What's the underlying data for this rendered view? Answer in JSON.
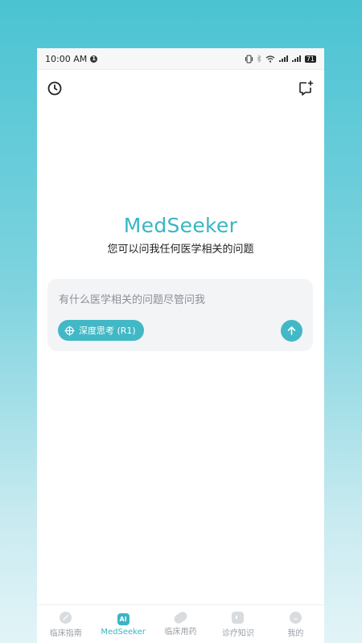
{
  "status_bar": {
    "time": "10:00 AM",
    "notification_count": "1",
    "battery": "71"
  },
  "header": {
    "history_icon": "clock-icon",
    "new_chat_icon": "new-chat-icon"
  },
  "brand": {
    "title": "MedSeeker",
    "subtitle": "您可以问我任何医学相关的问题"
  },
  "chat_input": {
    "placeholder": "有什么医学相关的问题尽管问我",
    "deep_think_label": "深度思考 (R1)",
    "send_icon": "arrow-up-icon"
  },
  "tabs": [
    {
      "label": "临床指南",
      "icon": "guide-icon",
      "active": false
    },
    {
      "label": "MedSeeker",
      "icon": "ai-icon",
      "icon_text": "AI",
      "active": true
    },
    {
      "label": "临床用药",
      "icon": "pill-icon",
      "active": false
    },
    {
      "label": "诊疗知识",
      "icon": "book-icon",
      "active": false
    },
    {
      "label": "我的",
      "icon": "profile-icon",
      "active": false
    }
  ],
  "colors": {
    "accent": "#42b8c6",
    "background_top": "#4bc3d2",
    "background_bottom": "#e3f4f7"
  }
}
